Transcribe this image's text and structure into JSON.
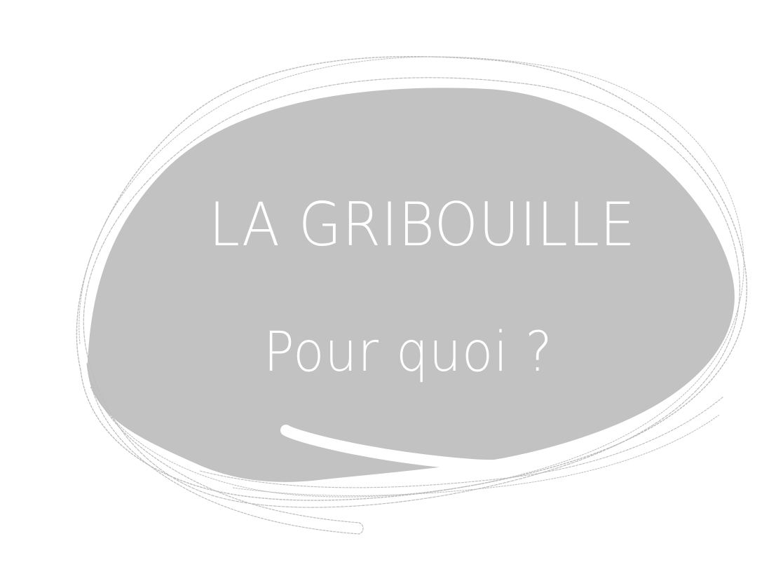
{
  "logo": {
    "title": "LA GRIBOUILLE",
    "subtitle": "Pour quoi ?"
  },
  "colors": {
    "background": "#ffffff",
    "blob_fill": "#c2c2c2",
    "stroke": "#bdbdbd",
    "text": "#ffffff"
  },
  "icons": {
    "speech_scribble": "speech-bubble-scribble-icon"
  }
}
